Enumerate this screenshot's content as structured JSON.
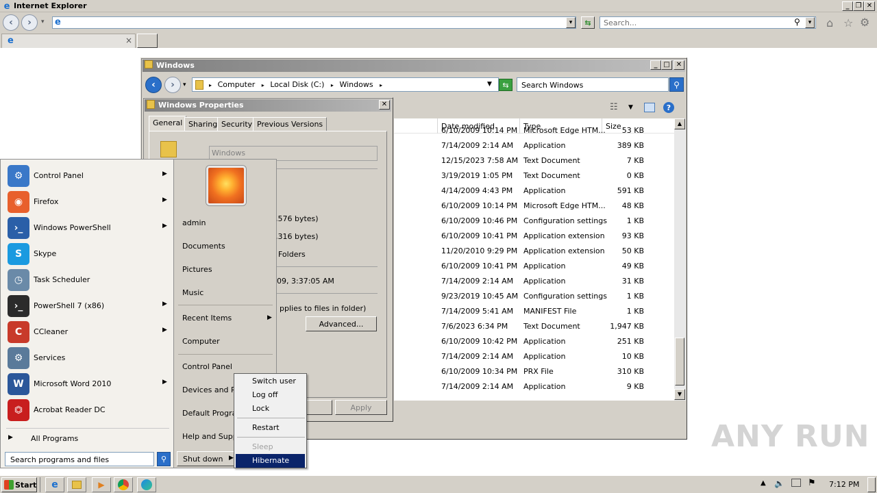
{
  "ie": {
    "title": "Internet Explorer",
    "search_placeholder": "Search...",
    "caption_min": "_",
    "caption_restore": "❐",
    "caption_close": "✕",
    "tab_close": "×"
  },
  "explorer": {
    "title": "Windows",
    "breadcrumb": [
      "Computer",
      "Local Disk (C:)",
      "Windows"
    ],
    "search_placeholder": "Search Windows",
    "columns": [
      "Date modified",
      "Type",
      "Size"
    ],
    "rows": [
      {
        "date": "6/10/2009 10:14 PM",
        "type": "Microsoft Edge HTM...",
        "size": "53 KB"
      },
      {
        "date": "7/14/2009 2:14 AM",
        "type": "Application",
        "size": "389 KB"
      },
      {
        "date": "12/15/2023 7:58 AM",
        "type": "Text Document",
        "size": "7 KB"
      },
      {
        "date": "3/19/2019 1:05 PM",
        "type": "Text Document",
        "size": "0 KB"
      },
      {
        "date": "4/14/2009 4:43 PM",
        "type": "Application",
        "size": "591 KB"
      },
      {
        "date": "6/10/2009 10:14 PM",
        "type": "Microsoft Edge HTM...",
        "size": "48 KB"
      },
      {
        "date": "6/10/2009 10:46 PM",
        "type": "Configuration settings",
        "size": "1 KB"
      },
      {
        "date": "6/10/2009 10:41 PM",
        "type": "Application extension",
        "size": "93 KB"
      },
      {
        "date": "11/20/2010 9:29 PM",
        "type": "Application extension",
        "size": "50 KB"
      },
      {
        "date": "6/10/2009 10:41 PM",
        "type": "Application",
        "size": "49 KB"
      },
      {
        "date": "7/14/2009 2:14 AM",
        "type": "Application",
        "size": "31 KB"
      },
      {
        "date": "9/23/2019 10:45 AM",
        "type": "Configuration settings",
        "size": "1 KB"
      },
      {
        "date": "7/14/2009 5:41 AM",
        "type": "MANIFEST File",
        "size": "1 KB"
      },
      {
        "date": "7/6/2023 6:34 PM",
        "type": "Text Document",
        "size": "1,947 KB"
      },
      {
        "date": "6/10/2009 10:42 PM",
        "type": "Application",
        "size": "251 KB"
      },
      {
        "date": "7/14/2009 2:14 AM",
        "type": "Application",
        "size": "10 KB"
      },
      {
        "date": "6/10/2009 10:34 PM",
        "type": "PRX File",
        "size": "310 KB"
      },
      {
        "date": "7/14/2009 2:14 AM",
        "type": "Application",
        "size": "9 KB"
      }
    ]
  },
  "props": {
    "title": "Windows Properties",
    "tabs": [
      "General",
      "Sharing",
      "Security",
      "Previous Versions"
    ],
    "name_value": "Windows",
    "frag_size": ",576 bytes)",
    "frag_size_disk": ",316 bytes)",
    "frag_contains": "Folders",
    "frag_created": "09, 3:37:05 AM",
    "frag_attr": "pplies to files in folder)",
    "advanced": "Advanced...",
    "cancel_frag": "cel",
    "apply": "Apply"
  },
  "start_menu": {
    "programs": [
      {
        "label": "Control Panel",
        "arrow": true
      },
      {
        "label": "Firefox",
        "arrow": true
      },
      {
        "label": "Windows PowerShell",
        "arrow": true
      },
      {
        "label": "Skype",
        "arrow": false
      },
      {
        "label": "Task Scheduler",
        "arrow": false
      },
      {
        "label": "PowerShell 7 (x86)",
        "arrow": true
      },
      {
        "label": "CCleaner",
        "arrow": true
      },
      {
        "label": "Services",
        "arrow": false
      },
      {
        "label": "Microsoft Word 2010",
        "arrow": true
      },
      {
        "label": "Acrobat Reader DC",
        "arrow": false
      }
    ],
    "all_programs": "All Programs",
    "search_placeholder": "Search programs and files",
    "right": [
      "admin",
      "Documents",
      "Pictures",
      "Music",
      "Recent Items",
      "Computer",
      "Control Panel",
      "Devices and Pri",
      "Default Program",
      "Help and Supp"
    ],
    "shutdown": "Shut down",
    "submenu": [
      "Switch user",
      "Log off",
      "Lock",
      "Restart",
      "Sleep",
      "Hibernate"
    ]
  },
  "taskbar": {
    "start": "Start",
    "clock": "7:12 PM"
  },
  "watermark": "ANY RUN"
}
